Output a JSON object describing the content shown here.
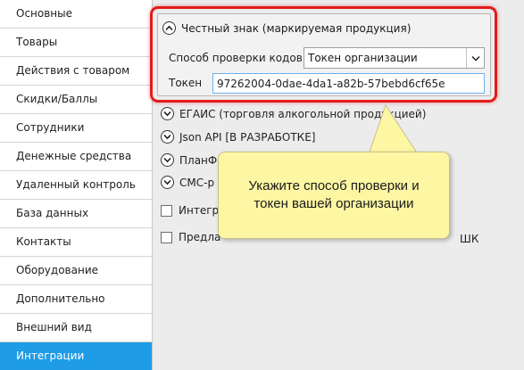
{
  "sidebar": {
    "items": [
      {
        "label": "Основные",
        "active": false
      },
      {
        "label": "Товары",
        "active": false
      },
      {
        "label": "Действия с товаром",
        "active": false
      },
      {
        "label": "Скидки/Баллы",
        "active": false
      },
      {
        "label": "Сотрудники",
        "active": false
      },
      {
        "label": "Денежные средства",
        "active": false
      },
      {
        "label": "Удаленный контроль",
        "active": false
      },
      {
        "label": "База данных",
        "active": false
      },
      {
        "label": "Контакты",
        "active": false
      },
      {
        "label": "Оборудование",
        "active": false
      },
      {
        "label": "Дополнительно",
        "active": false
      },
      {
        "label": "Внешний вид",
        "active": false
      },
      {
        "label": "Интеграции",
        "active": true
      }
    ],
    "active_color": "#1e9ce6"
  },
  "honest_sign": {
    "title": "Честный знак (маркируемая продукция)",
    "method_label": "Способ проверки кодов",
    "method_value": "Токен организации",
    "token_label": "Токен",
    "token_value": "97262004-0dae-4da1-a82b-57bebd6cf65e",
    "collapse_icon": "chevron-up-icon"
  },
  "sections": [
    {
      "label": "ЕГАИС (торговля алкогольной продукцией)",
      "kind": "expander"
    },
    {
      "label": "Json API [В РАЗРАБОТКЕ]",
      "kind": "expander"
    },
    {
      "label": "ПланФ",
      "kind": "expander"
    },
    {
      "label": "СМС-р",
      "kind": "expander"
    },
    {
      "label": "Интегр",
      "kind": "checkbox",
      "checked": false
    },
    {
      "label": "Предла",
      "tail": "ШК",
      "kind": "checkbox",
      "checked": false
    }
  ],
  "callout": {
    "text": "Укажите способ проверки и токен вашей организации"
  },
  "colors": {
    "highlight": "#e21b1b",
    "callout_bg": "#fdf6a3"
  }
}
